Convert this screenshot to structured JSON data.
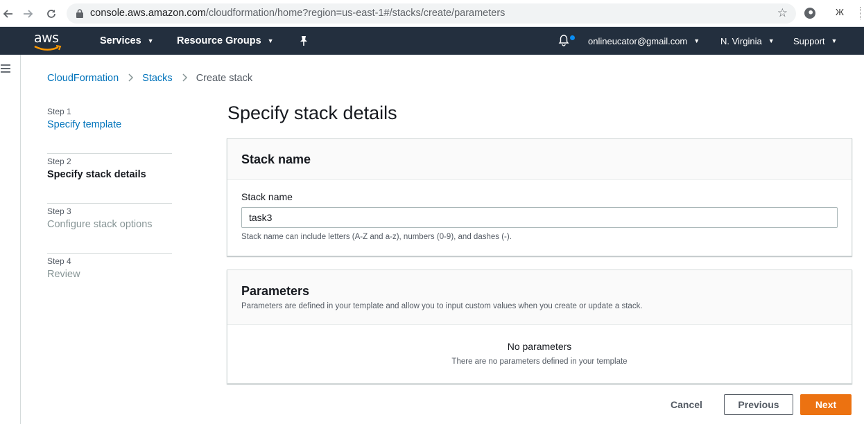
{
  "browser": {
    "url_host": "console.aws.amazon.com",
    "url_path": "/cloudformation/home?region=us-east-1#/stacks/create/parameters",
    "ext_label": "Ж"
  },
  "header": {
    "logo": "aws",
    "services": "Services",
    "resource_groups": "Resource Groups",
    "account": "onlineucator@gmail.com",
    "region": "N. Virginia",
    "support": "Support"
  },
  "breadcrumb": {
    "items": [
      "CloudFormation",
      "Stacks",
      "Create stack"
    ]
  },
  "steps": [
    {
      "num": "Step 1",
      "title": "Specify template"
    },
    {
      "num": "Step 2",
      "title": "Specify stack details"
    },
    {
      "num": "Step 3",
      "title": "Configure stack options"
    },
    {
      "num": "Step 4",
      "title": "Review"
    }
  ],
  "page_title": "Specify stack details",
  "stack_panel": {
    "title": "Stack name",
    "field_label": "Stack name",
    "field_value": "task3",
    "hint": "Stack name can include letters (A-Z and a-z), numbers (0-9), and dashes (-)."
  },
  "params_panel": {
    "title": "Parameters",
    "description": "Parameters are defined in your template and allow you to input custom values when you create or update a stack.",
    "empty_title": "No parameters",
    "empty_desc": "There are no parameters defined in your template"
  },
  "footer": {
    "cancel": "Cancel",
    "previous": "Previous",
    "next": "Next"
  },
  "colors": {
    "header_bg": "#232f3e",
    "link": "#0073bb",
    "primary": "#ec7211"
  },
  "icons": [
    "back-arrow-icon",
    "forward-arrow-icon",
    "reload-icon",
    "lock-icon",
    "star-icon",
    "pin-icon",
    "bell-icon",
    "menu-icon",
    "chevron-right-icon",
    "caret-down-icon"
  ]
}
